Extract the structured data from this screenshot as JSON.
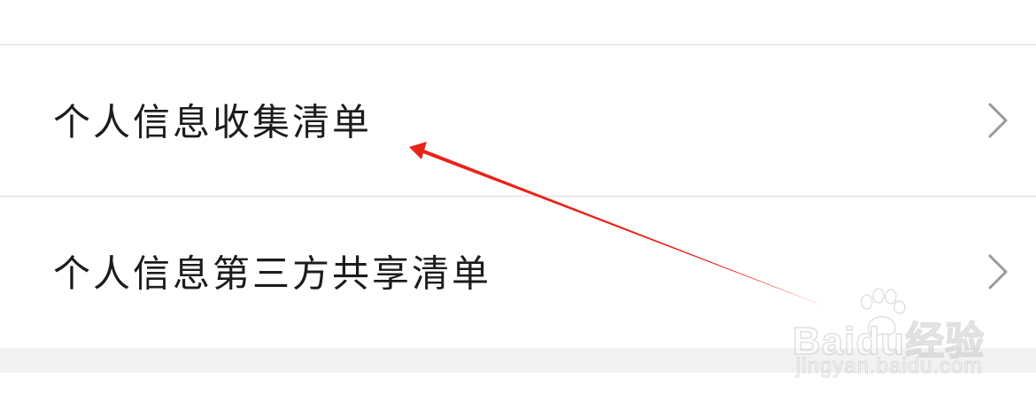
{
  "settings_list": {
    "items": [
      {
        "label": "个人信息收集清单",
        "icon": "chevron-right-icon"
      },
      {
        "label": "个人信息第三方共享清单",
        "icon": "chevron-right-icon"
      }
    ]
  },
  "annotation": {
    "arrow_color": "#e8231a"
  },
  "watermark": {
    "brand": "Baidu",
    "suffix": "经验",
    "url": "jingyan.baidu.com"
  },
  "colors": {
    "text": "#1c1c1c",
    "divider": "#dcdcdc",
    "chevron": "#9a9a9a",
    "footer_band": "#f2f2f2"
  }
}
